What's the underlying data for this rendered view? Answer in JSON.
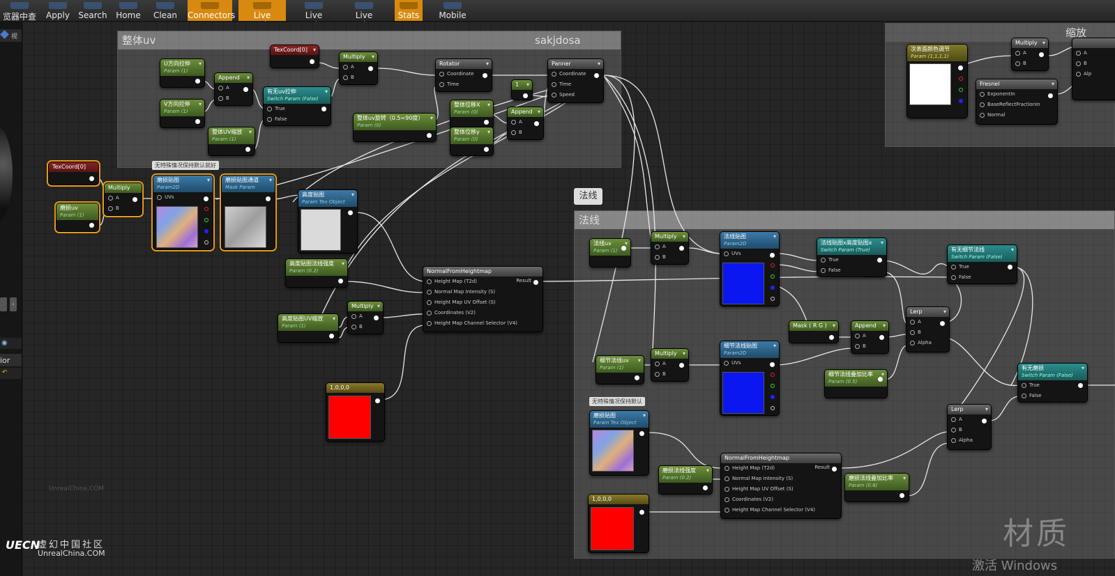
{
  "toolbar": {
    "items": [
      {
        "label": "览器中查找",
        "active": false
      },
      {
        "label": "Apply",
        "active": false
      },
      {
        "label": "Search",
        "active": false
      },
      {
        "label": "Home",
        "active": false
      },
      {
        "label": "Clean Up",
        "active": false
      },
      {
        "label": "Connectors",
        "active": true
      },
      {
        "label": "Live Preview",
        "active": true
      },
      {
        "label": "Live Nodes",
        "active": false
      },
      {
        "label": "Live Update",
        "active": false
      },
      {
        "label": "Stats",
        "active": true
      },
      {
        "label": "Mobile Stats",
        "active": false
      }
    ]
  },
  "left_panel": {
    "tab_label": "视",
    "side_text": "ior"
  },
  "comments": {
    "uv_title": "整体uv",
    "uv_right": "sakjdosa",
    "normal_title": "法线",
    "normal_tag": "法线",
    "right_title": "缩放"
  },
  "tips": {
    "tip1": "无特殊情况保持默认就好",
    "tip2": "无特殊情况保持默认"
  },
  "nodes": {
    "texcoord_top": {
      "title": "TexCoord[0]"
    },
    "u_stretch": {
      "title": "U方向拉伸",
      "sub": "Param (1)"
    },
    "v_stretch": {
      "title": "V方向拉伸",
      "sub": "Param (1)"
    },
    "append1": {
      "title": "Append",
      "a": "A",
      "b": "B"
    },
    "multiply1": {
      "title": "Multiply",
      "a": "A",
      "b": "B"
    },
    "uv_switch": {
      "title": "有无uv拉伸",
      "sub": "Switch Param (False)",
      "t": "True",
      "f": "False"
    },
    "uv_scale": {
      "title": "整体UV缩放",
      "sub": "Param (1)"
    },
    "rotator": {
      "title": "Rotator",
      "c": "Coordinate",
      "t": "Time"
    },
    "uv_rot": {
      "title": "整体uv旋转（0.5=90度）",
      "sub": "Param (0)"
    },
    "const1": {
      "title": "1"
    },
    "offset_x": {
      "title": "整体位移X",
      "sub": "Param (0)"
    },
    "offset_y": {
      "title": "整体位移y",
      "sub": "Param (0)"
    },
    "append2": {
      "title": "Append",
      "a": "A",
      "b": "B"
    },
    "panner": {
      "title": "Panner",
      "c": "Coordinate",
      "t": "Time",
      "s": "Speed"
    },
    "texcoord_left": {
      "title": "TexCoord[0]"
    },
    "wear_uv": {
      "title": "磨损uv",
      "sub": "Param (1)"
    },
    "multiply2": {
      "title": "Multiply",
      "a": "A",
      "b": "B"
    },
    "wear_tex": {
      "title": "磨损贴图",
      "sub": "Param2D",
      "uvs": "UVs"
    },
    "wear_channel": {
      "title": "磨损贴图通道",
      "sub": "Mask Param"
    },
    "height_tex": {
      "title": "高度贴图",
      "sub": "Param Tex Object"
    },
    "height_intensity": {
      "title": "高度贴图法线强度",
      "sub": "Param (0.2)"
    },
    "height_uvscale": {
      "title": "高度贴图UV缩放",
      "sub": "Param (1)"
    },
    "multiply3": {
      "title": "Multiply",
      "a": "A",
      "b": "B"
    },
    "nfh1": {
      "title": "NormalFromHeightmap",
      "p1": "Height Map (T2d)",
      "p2": "Normal Map Intensity (S)",
      "p3": "Height Map UV Offset (S)",
      "p4": "Coordinates (V2)",
      "p5": "Height Map Channel Selector (V4)",
      "out": "Result"
    },
    "vec_red1": {
      "title": "1,0,0,0"
    },
    "normal_uv": {
      "title": "法线uv",
      "sub": "Param (1)"
    },
    "multiply4": {
      "title": "Multiply",
      "a": "A",
      "b": "B"
    },
    "normal_tex": {
      "title": "法线贴图",
      "sub": "Param2D",
      "uvs": "UVs"
    },
    "normal_switch": {
      "title": "法线贴图x高度贴图x",
      "sub": "Switch Param (True)",
      "t": "True",
      "f": "False"
    },
    "detail_switch": {
      "title": "有无细节法线",
      "sub": "Switch Param (False)",
      "t": "True",
      "f": "False"
    },
    "lerp1": {
      "title": "Lerp",
      "a": "A",
      "b": "B",
      "alpha": "Alpha"
    },
    "mask_rg": {
      "title": "Mask ( R G )"
    },
    "append3": {
      "title": "Append",
      "a": "A",
      "b": "B"
    },
    "detail_uv": {
      "title": "细节法线uv",
      "sub": "Param (1)"
    },
    "multiply5": {
      "title": "Multiply",
      "a": "A",
      "b": "B"
    },
    "detail_tex": {
      "title": "细节法线贴图",
      "sub": "Param2D",
      "uvs": "UVs"
    },
    "detail_blend": {
      "title": "细节法线叠加比率",
      "sub": "Param (0.5)"
    },
    "wear_switch": {
      "title": "有无磨损",
      "sub": "Switch Param (False)",
      "t": "True",
      "f": "False"
    },
    "lerp2": {
      "title": "Lerp",
      "a": "A",
      "b": "B",
      "alpha": "Alpha"
    },
    "wear_tex2": {
      "title": "磨损贴图",
      "sub": "Param Tex Object"
    },
    "wear_normal_str": {
      "title": "磨损法线强度",
      "sub": "Param (0.2)"
    },
    "nfh2": {
      "title": "NormalFromHeightmap",
      "p1": "Height Map (T2d)",
      "p2": "Normal Map Intensity (S)",
      "p3": "Height Map UV Offset (S)",
      "p4": "Coordinates (V2)",
      "p5": "Height Map Channel Selector (V4)",
      "out": "Result"
    },
    "wear_blend": {
      "title": "磨损法线叠加比率",
      "sub": "Param (0.8)"
    },
    "vec_red2": {
      "title": "1,0,0,0"
    },
    "right_color": {
      "title": "次表面颜色调节",
      "sub": "Param (1,1,1,1)"
    },
    "multiply6": {
      "title": "Multiply",
      "a": "A",
      "b": "B"
    },
    "fresnel": {
      "title": "Fresnel",
      "p1": "ExponentIn",
      "p2": "BaseReflectFractionIn",
      "p3": "Normal"
    }
  },
  "logo": {
    "mark": "UECN",
    "name": "虚幻中国社区",
    "url": "UnrealChina.COM",
    "faint": "UnrealChina.COM"
  },
  "watermark": "材质",
  "activate": "激活 Windows",
  "colors": {
    "accent": "#d8890f",
    "selection": "#e49b1c",
    "param_green": "#4e7a2a",
    "texture_blue": "#1f4c6c",
    "normal_blue": "#0a17f0",
    "vector_red": "#ff0000"
  }
}
